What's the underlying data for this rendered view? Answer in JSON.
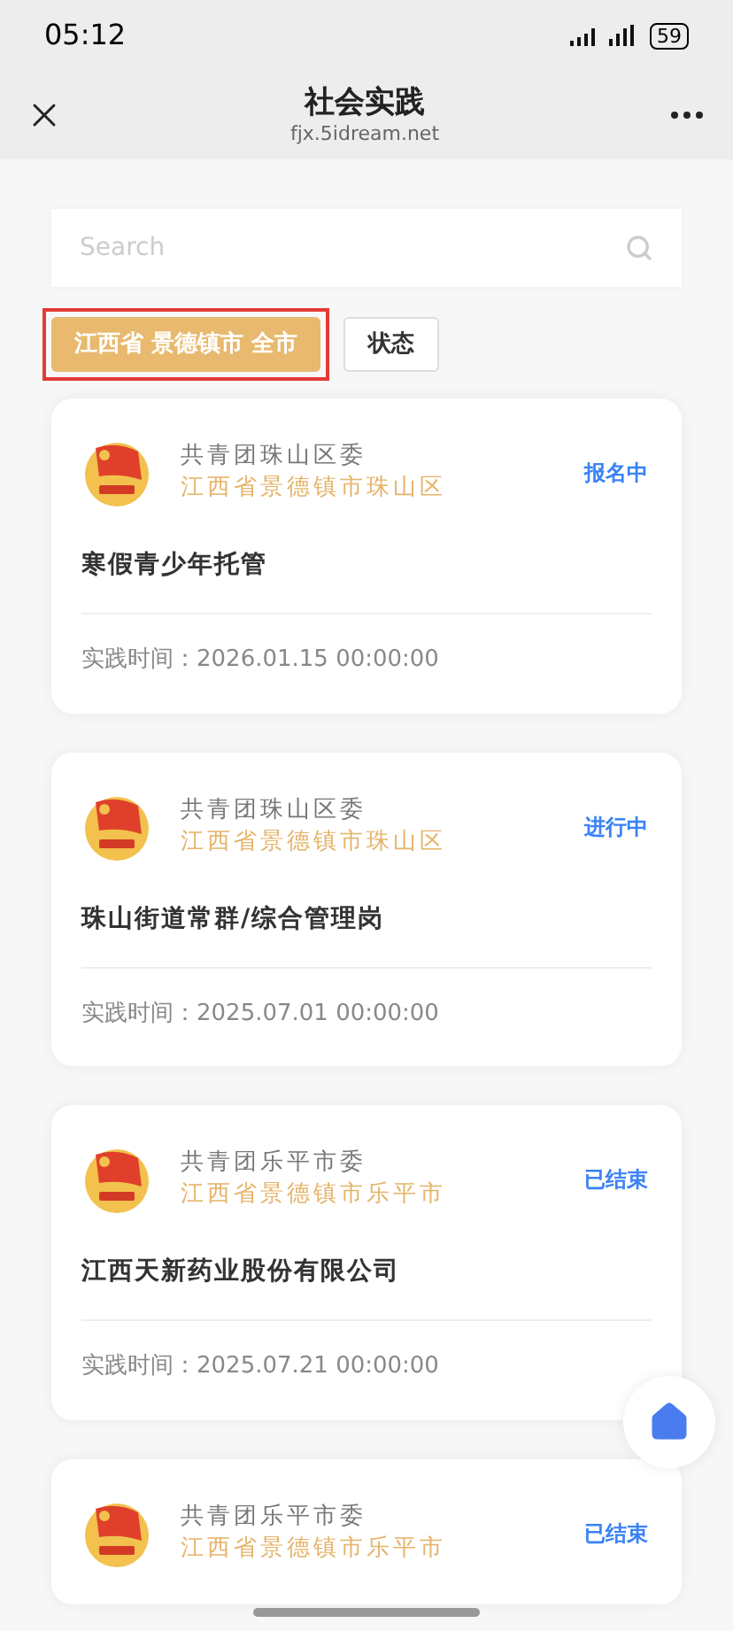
{
  "status_bar": {
    "time": "05:12",
    "battery": "59"
  },
  "header": {
    "title": "社会实践",
    "subtitle": "fjx.5idream.net"
  },
  "search": {
    "placeholder": "Search"
  },
  "filters": [
    {
      "label": "江西省 景德镇市 全市",
      "selected": true,
      "highlighted": true
    },
    {
      "label": "状态",
      "selected": false,
      "highlighted": false
    }
  ],
  "cards": [
    {
      "org": "共青团珠山区委",
      "region": "江西省景德镇市珠山区",
      "status": "报名中",
      "title": "寒假青少年托管",
      "time": "实践时间：2026.01.15 00:00:00"
    },
    {
      "org": "共青团珠山区委",
      "region": "江西省景德镇市珠山区",
      "status": "进行中",
      "title": "珠山街道常群/综合管理岗",
      "time": "实践时间：2025.07.01 00:00:00"
    },
    {
      "org": "共青团乐平市委",
      "region": "江西省景德镇市乐平市",
      "status": "已结束",
      "title": "江西天新药业股份有限公司",
      "time": "实践时间：2025.07.21 00:00:00"
    },
    {
      "org": "共青团乐平市委",
      "region": "江西省景德镇市乐平市",
      "status": "已结束"
    }
  ]
}
